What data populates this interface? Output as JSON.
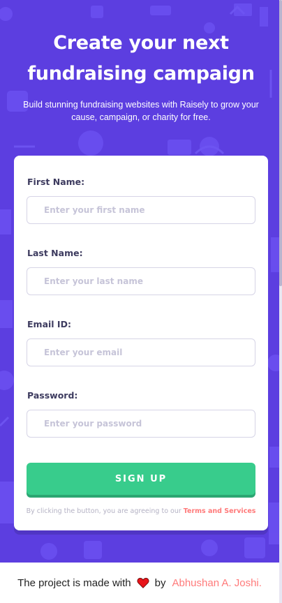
{
  "hero": {
    "title_line1": "Create your next",
    "title_line2": "fundraising campaign",
    "subtitle_line1": "Build stunning fundraising websites with Raisely to grow your",
    "subtitle_line2": "cause, campaign, or charity for free."
  },
  "form": {
    "first_name": {
      "label": "First Name:",
      "placeholder": "Enter your first name"
    },
    "last_name": {
      "label": "Last Name:",
      "placeholder": "Enter your last name"
    },
    "email": {
      "label": "Email ID:",
      "placeholder": "Enter your email"
    },
    "password": {
      "label": "Password:",
      "placeholder": "Enter your password"
    },
    "submit_label": "SIGN UP",
    "terms_text": "By clicking the button, you are agreeing to our ",
    "terms_link": "Terms and Services"
  },
  "footer": {
    "text": "The project is made with",
    "heart_icon": "heart-icon",
    "by": "by",
    "author": "Abhushan A. Joshi."
  },
  "colors": {
    "background": "#5c3ee0",
    "accent_green": "#38cc8c",
    "link_red": "#ff7a7a",
    "label": "#3d3b5f"
  }
}
